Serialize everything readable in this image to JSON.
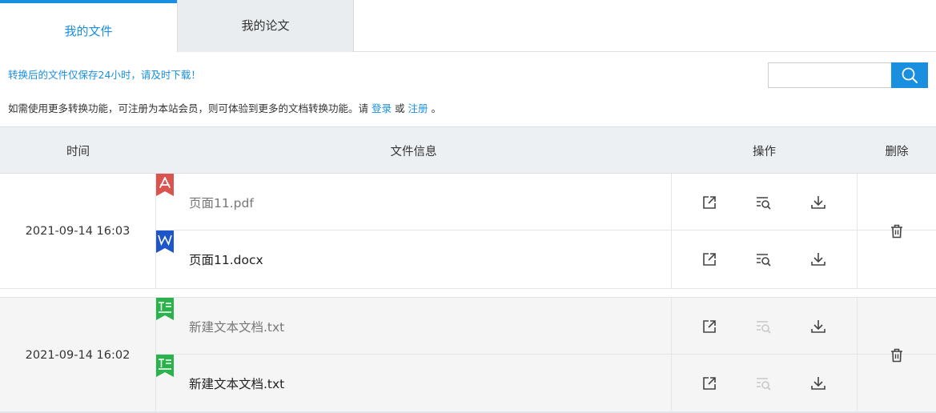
{
  "tabs": {
    "my_files": "我的文件",
    "my_papers": "我的论文"
  },
  "notice": {
    "line1": "转换后的文件仅保存24小时，请及时下载！",
    "line2_pre": "如需使用更多转换功能，可注册为本站会员，则可体验到更多的文档转换功能。请",
    "login": "登录",
    "or": "或",
    "register": "注册",
    "line2_post": "。"
  },
  "search": {
    "value": "",
    "placeholder": ""
  },
  "table": {
    "headers": {
      "time": "时间",
      "file_info": "文件信息",
      "actions": "操作",
      "delete": "删除"
    },
    "groups": [
      {
        "time": "2021-09-14 16:03",
        "files": [
          {
            "name": "页面11.pdf",
            "type": "pdf-icon"
          },
          {
            "name": "页面11.docx",
            "type": "word-icon"
          }
        ]
      },
      {
        "time": "2021-09-14 16:02",
        "files": [
          {
            "name": "新建文本文档.txt",
            "type": "txt-icon"
          },
          {
            "name": "新建文本文档.txt",
            "type": "txt-icon"
          }
        ]
      }
    ]
  },
  "colors": {
    "accent": "#1a8fe0",
    "pdf": "#d9534f",
    "word": "#1e56c9",
    "txt": "#2bb24c"
  }
}
